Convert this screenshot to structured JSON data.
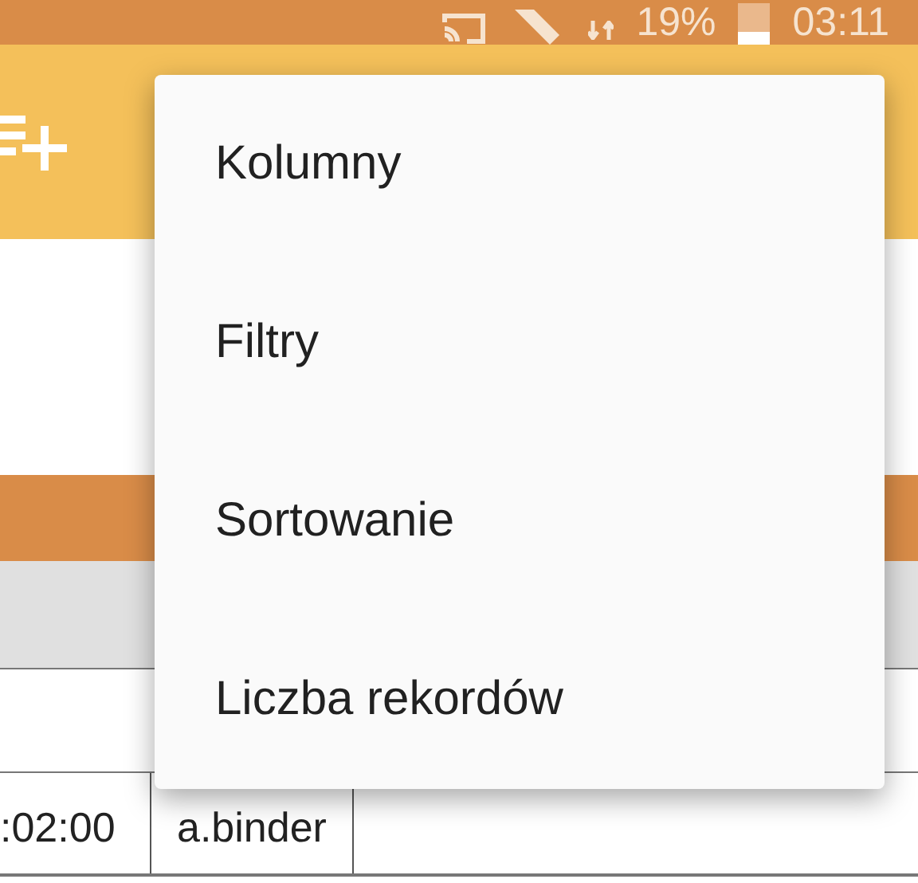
{
  "status_bar": {
    "battery": "19%",
    "time": "03:11"
  },
  "menu": {
    "items": [
      {
        "label": "Kolumny"
      },
      {
        "label": "Filtry"
      },
      {
        "label": "Sortowanie"
      },
      {
        "label": "Liczba rekordów"
      }
    ]
  },
  "table": {
    "rows": [
      {
        "cells": [
          ":02:00",
          "a.binder"
        ]
      }
    ]
  }
}
